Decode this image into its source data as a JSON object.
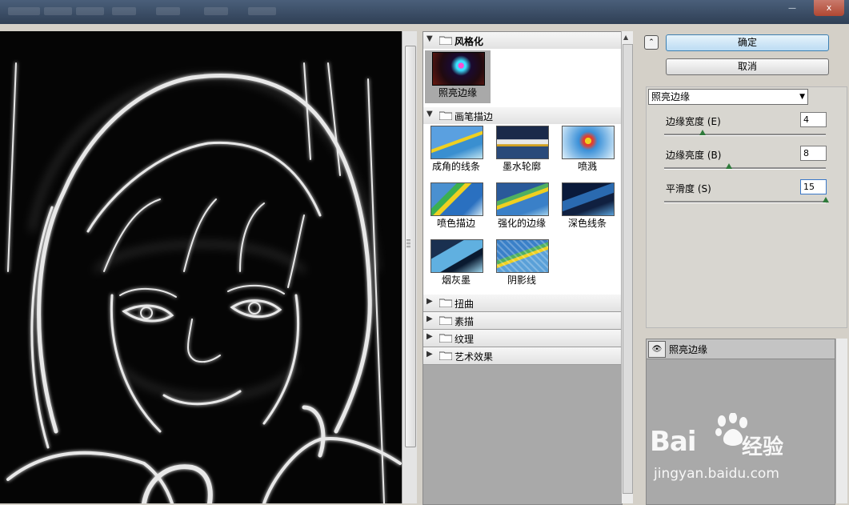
{
  "window": {
    "close_label": "x",
    "min_label": "—"
  },
  "gallery": {
    "categories": [
      {
        "label": "风格化",
        "expanded": true,
        "items": [
          {
            "label": "照亮边缘",
            "selected": true
          }
        ]
      },
      {
        "label": "画笔描边",
        "expanded": true,
        "items": [
          {
            "label": "成角的线条"
          },
          {
            "label": "墨水轮廓"
          },
          {
            "label": "喷溅"
          },
          {
            "label": "喷色描边"
          },
          {
            "label": "强化的边缘"
          },
          {
            "label": "深色线条"
          },
          {
            "label": "烟灰墨"
          },
          {
            "label": "阴影线"
          }
        ]
      },
      {
        "label": "扭曲",
        "expanded": false
      },
      {
        "label": "素描",
        "expanded": false
      },
      {
        "label": "纹理",
        "expanded": false
      },
      {
        "label": "艺术效果",
        "expanded": false
      }
    ]
  },
  "buttons": {
    "collapse_label": "⌃",
    "ok_label": "确定",
    "cancel_label": "取消"
  },
  "settings": {
    "filter_name": "照亮边缘",
    "dropdown_arrow": "▼",
    "params": [
      {
        "label": "边缘宽度 (E)",
        "value": "4",
        "fraction": 0.24
      },
      {
        "label": "边缘亮度 (B)",
        "value": "8",
        "fraction": 0.4
      },
      {
        "label": "平滑度 (S)",
        "value": "15",
        "fraction": 1.0
      }
    ]
  },
  "layers": {
    "eye_icon": "👁",
    "items": [
      {
        "name": "照亮边缘"
      }
    ]
  },
  "watermark": {
    "brand": "Bai",
    "brand_paw": "du",
    "brand_cn": "经验",
    "url": "jingyan.baidu.com"
  },
  "colors": {
    "accent_knob": "#2e7a3a",
    "primary_button": "#bcdcf3",
    "preview_bg": "#050505"
  }
}
